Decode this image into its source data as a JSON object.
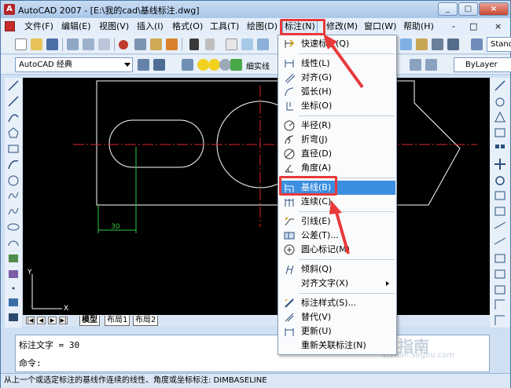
{
  "window": {
    "title": "AutoCAD 2007 - [E:\\我的cad\\基线标注.dwg]",
    "minimize": "_",
    "restore": "□",
    "close": "×"
  },
  "menubar": {
    "items": [
      "文件(F)",
      "编辑(E)",
      "视图(V)",
      "插入(I)",
      "格式(O)",
      "工具(T)",
      "绘图(D)",
      "标注(N)",
      "修改(M)",
      "窗口(W)",
      "帮助(H)"
    ],
    "doc_min": "-",
    "doc_restore": "□",
    "doc_close": "×"
  },
  "toolbar": {
    "workspace": "AutoCAD 经典",
    "layer": "细实线",
    "bylayer": "ByLayer",
    "style": "Stand"
  },
  "dimension_menu": {
    "items": [
      {
        "label": "快速标注(Q)",
        "icon": "quick-dim-icon"
      },
      {
        "label": "线性(L)",
        "icon": "linear-dim-icon"
      },
      {
        "label": "对齐(G)",
        "icon": "aligned-dim-icon"
      },
      {
        "label": "弧长(H)",
        "icon": "arc-length-icon"
      },
      {
        "label": "坐标(O)",
        "icon": "ordinate-icon"
      },
      {
        "label": "半径(R)",
        "icon": "radius-icon"
      },
      {
        "label": "折弯(J)",
        "icon": "jogged-icon"
      },
      {
        "label": "直径(D)",
        "icon": "diameter-icon"
      },
      {
        "label": "角度(A)",
        "icon": "angular-icon"
      },
      {
        "label": "基线(B)",
        "icon": "baseline-icon"
      },
      {
        "label": "连续(C)",
        "icon": "continue-icon"
      },
      {
        "label": "引线(E)",
        "icon": "leader-icon"
      },
      {
        "label": "公差(T)...",
        "icon": "tolerance-icon"
      },
      {
        "label": "圆心标记(M)",
        "icon": "center-mark-icon"
      },
      {
        "label": "倾斜(Q)",
        "icon": "oblique-icon"
      },
      {
        "label": "对齐文字(X)",
        "icon": ""
      },
      {
        "label": "标注样式(S)...",
        "icon": "dim-style-icon"
      },
      {
        "label": "替代(V)",
        "icon": "override-icon"
      },
      {
        "label": "更新(U)",
        "icon": "update-icon"
      },
      {
        "label": "重新关联标注(N)",
        "icon": ""
      }
    ]
  },
  "drawing": {
    "dimension_text": "30",
    "axis_x": "X",
    "axis_y": "Y"
  },
  "layout_tabs": [
    "模型",
    "布局1",
    "布局2"
  ],
  "command": {
    "line1": "标注文字 = 30",
    "line2": "命令:"
  },
  "status": {
    "text": "从上一个或选定标注的基线作连续的线性、角度或坐标标注:  DIMBASELINE"
  },
  "watermark": {
    "text": "搜狗指南",
    "url": "zhinan.sogou.com"
  },
  "colors": {
    "highlight": "#3b8ee0",
    "annotation": "#e8393b",
    "canvas": "#000000",
    "centerline": "#e0272a",
    "dimension": "#2ecc40"
  }
}
